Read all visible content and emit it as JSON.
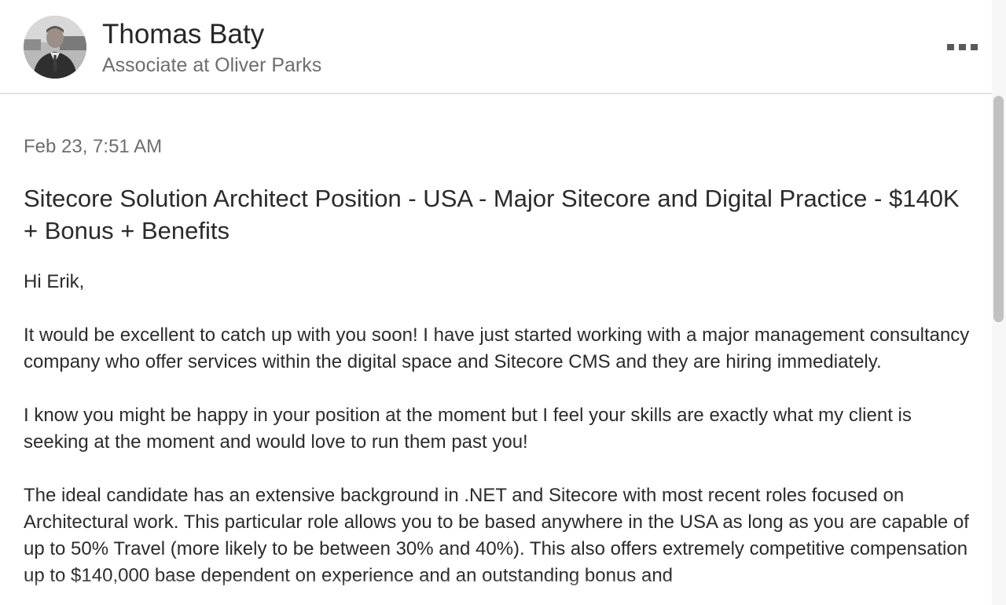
{
  "sender": {
    "name": "Thomas Baty",
    "headline": "Associate at Oliver Parks",
    "avatar_icon": "profile-photo"
  },
  "header": {
    "more_icon": "ellipsis-icon"
  },
  "message": {
    "timestamp": "Feb 23, 7:51 AM",
    "subject": "Sitecore Solution Architect Position - USA - Major Sitecore and Digital Practice - $140K + Bonus + Benefits",
    "paragraphs": [
      "Hi Erik,",
      "It would be excellent to catch up with you soon! I have just started working with a major management consultancy company who offer services within the digital space and Sitecore CMS and they are hiring immediately.",
      "I know you might be happy in your position at the moment but I feel your skills are exactly what my client is seeking at the moment and would love to run them past you!",
      "The ideal candidate has an extensive background in .NET and Sitecore with most recent roles focused on Architectural work. This particular role allows you to be based anywhere in the USA as long as you are capable of up to 50% Travel (more likely to be between 30% and 40%). This also offers extremely competitive compensation up to $140,000 base dependent on experience and an outstanding bonus and"
    ]
  },
  "colors": {
    "text_primary": "#2b2b2b",
    "text_secondary": "#6e6e6e",
    "divider": "#e3e3e3",
    "scrollbar_thumb": "#c1c1c1"
  }
}
